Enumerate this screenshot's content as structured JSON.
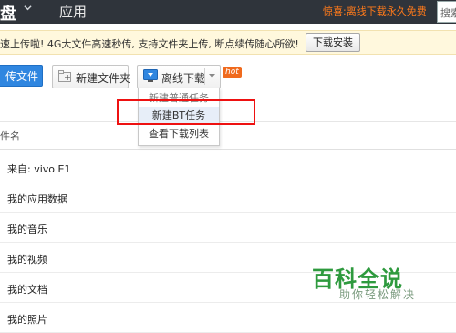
{
  "topbar": {
    "logo_text": "盘",
    "nav_app": "应用",
    "promo": "惊喜:离线下载永久免费",
    "search_placeholder": "搜索"
  },
  "notice": {
    "text": "速上传啦! 4G大文件高速秒传, 支持文件夹上传, 断点续传随心所欲!",
    "button": "下载安装"
  },
  "toolbar": {
    "upload_label": "传文件",
    "new_folder_label": "新建文件夹",
    "offline_label": "离线下载",
    "hot_badge": "hot"
  },
  "dropdown": {
    "items": [
      "新建普通任务",
      "新建BT任务",
      "查看下载列表"
    ]
  },
  "file_list": {
    "column_filename": "件名",
    "rows": [
      "来自: vivo E1",
      "我的应用数据",
      "我的音乐",
      "我的视频",
      "我的文档",
      "我的照片"
    ]
  },
  "watermark": {
    "title": "百科全说",
    "subtitle": "助你轻松解决"
  }
}
